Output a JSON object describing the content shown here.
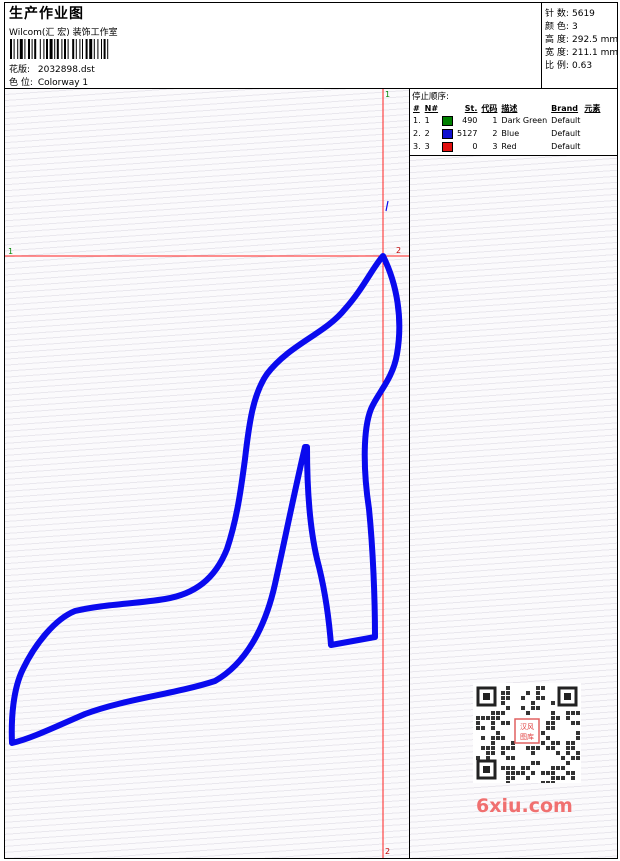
{
  "header": {
    "title": "生产作业图",
    "subtitle": "Wilcom(汇 宏) 装饰工作室",
    "design_label": "花版:",
    "design_value": "2032898.dst",
    "colorway_label": "色 位:",
    "colorway_value": "Colorway 1"
  },
  "stats": [
    {
      "label": "针 数:",
      "value": "5619"
    },
    {
      "label": "颜 色:",
      "value": "3"
    },
    {
      "label": "高 度:",
      "value": "292.5 mm"
    },
    {
      "label": "宽 度:",
      "value": "211.1 mm"
    },
    {
      "label": "比 例:",
      "value": "0.63"
    }
  ],
  "color_table": {
    "title": "停止顺序:",
    "headers": [
      "#",
      "N#",
      "St.",
      "代码",
      "描述",
      "Brand",
      "元素"
    ],
    "rows": [
      {
        "idx": "1.",
        "n": "1",
        "color": "#008000",
        "stitches": "490",
        "code": "1",
        "desc": "Dark Green",
        "brand": "Default",
        "element": ""
      },
      {
        "idx": "2.",
        "n": "2",
        "color": "#1010d0",
        "stitches": "5127",
        "code": "2",
        "desc": "Blue",
        "brand": "Default",
        "element": ""
      },
      {
        "idx": "3.",
        "n": "3",
        "color": "#e01010",
        "stitches": "0",
        "code": "3",
        "desc": "Red",
        "brand": "Default",
        "element": ""
      }
    ]
  },
  "markers": {
    "top": "1",
    "left": "1",
    "right": "2",
    "bottom": "2"
  },
  "colors": {
    "outline": "#0a0aee",
    "crosshair": "#ff2020"
  },
  "watermark": "6xiu.com",
  "qr_badge": "汉风图库"
}
